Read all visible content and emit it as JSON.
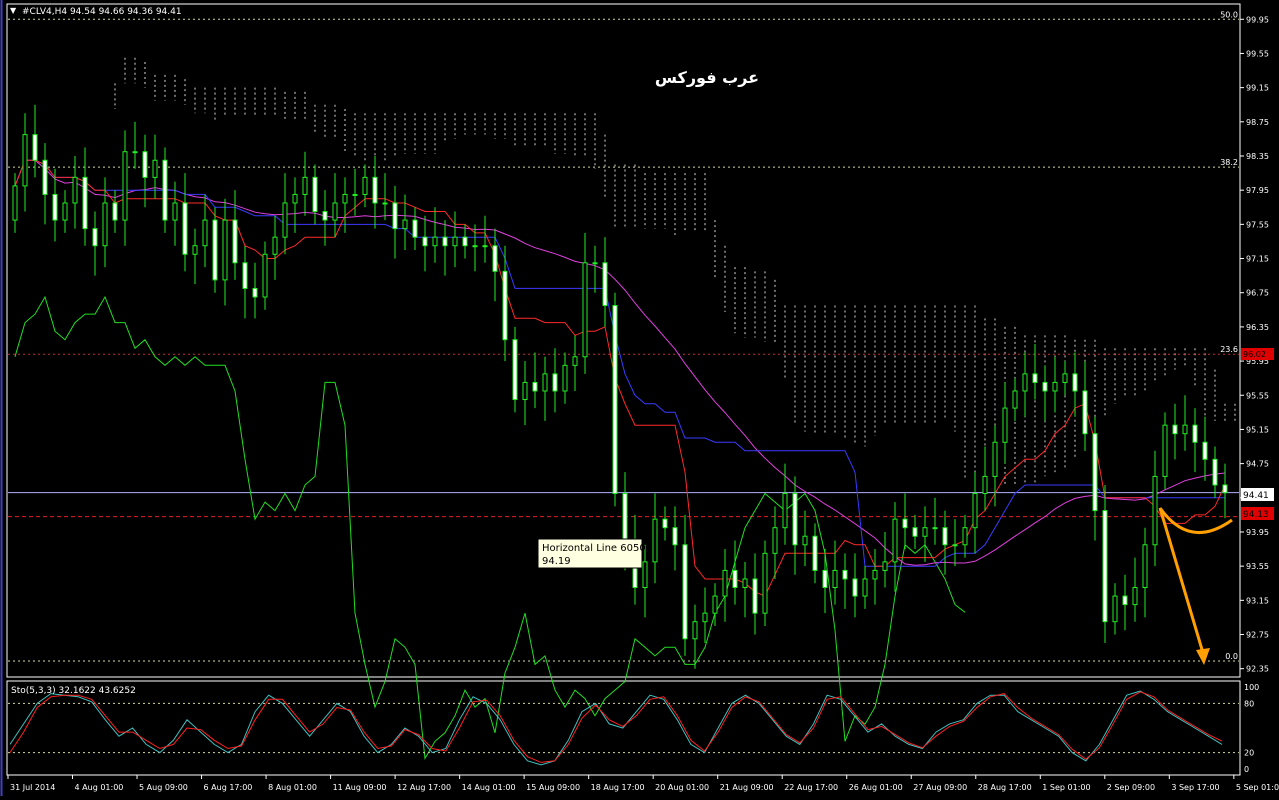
{
  "header": {
    "symbol_info": "#CLV4,H4  94.54 94.66 94.36 94.41",
    "watermark": "عرب فوركس"
  },
  "indicator": {
    "label": "Sto(5,3,3) 32.1622 43.6252",
    "levels": [
      100,
      80,
      20,
      0
    ],
    "level_labels": [
      "100",
      "80",
      "20",
      "0"
    ]
  },
  "fib": {
    "levels": [
      {
        "label": "50.0",
        "price": 99.95
      },
      {
        "label": "38.2",
        "price": 98.22
      },
      {
        "label": "23.6",
        "price": 96.03
      },
      {
        "label": "0.0",
        "price": 92.44
      }
    ]
  },
  "tooltip": {
    "line1": "Horizontal Line 6050",
    "line2": "94.19"
  },
  "price_tags": {
    "current": "94.41",
    "red_level": "94.13",
    "red_level_top": "96.02"
  },
  "chart_data": [
    {
      "type": "candlestick",
      "ylim": [
        92.44,
        100.0
      ],
      "y_ticks": [
        "99.95",
        "99.55",
        "99.15",
        "98.75",
        "98.35",
        "97.95",
        "97.55",
        "97.15",
        "96.75",
        "96.35",
        "95.95",
        "95.55",
        "95.15",
        "94.75",
        "94.35",
        "93.95",
        "93.55",
        "93.15",
        "92.75",
        "92.35"
      ],
      "x_ticks": [
        "31 Jul 2014",
        "4 Aug 01:00",
        "5 Aug 09:00",
        "6 Aug 17:00",
        "8 Aug 01:00",
        "11 Aug 09:00",
        "12 Aug 17:00",
        "14 Aug 01:00",
        "15 Aug 09:00",
        "18 Aug 17:00",
        "20 Aug 01:00",
        "21 Aug 09:00",
        "22 Aug 17:00",
        "26 Aug 01:00",
        "27 Aug 09:00",
        "28 Aug 17:00",
        "1 Sep 01:00",
        "2 Sep 09:00",
        "3 Sep 17:00",
        "5 Sep 01:00"
      ],
      "closes": [
        98.0,
        98.6,
        98.3,
        97.9,
        97.6,
        97.8,
        98.1,
        97.5,
        97.3,
        97.8,
        97.6,
        98.4,
        98.4,
        98.1,
        98.3,
        97.6,
        97.8,
        97.2,
        97.3,
        97.6,
        96.9,
        97.6,
        97.1,
        96.8,
        96.7,
        97.2,
        97.4,
        97.8,
        97.9,
        98.1,
        97.7,
        97.6,
        97.8,
        97.9,
        97.9,
        98.1,
        97.8,
        97.8,
        97.5,
        97.6,
        97.4,
        97.3,
        97.4,
        97.3,
        97.4,
        97.3,
        97.3,
        97.3,
        97.0,
        96.2,
        95.5,
        95.7,
        95.6,
        95.8,
        95.6,
        95.9,
        96.0,
        97.1,
        97.1,
        96.6,
        94.4,
        93.8,
        93.3,
        93.6,
        94.1,
        94.0,
        93.8,
        92.7,
        92.9,
        93.0,
        93.2,
        93.5,
        93.3,
        93.4,
        93.0,
        93.7,
        94.0,
        94.4,
        93.8,
        93.9,
        93.5,
        93.3,
        93.5,
        93.4,
        93.2,
        93.4,
        93.5,
        93.6,
        94.1,
        94.0,
        93.9,
        94.0,
        94.0,
        93.8,
        93.8,
        94.0,
        94.4,
        94.6,
        95.0,
        95.4,
        95.6,
        95.8,
        95.7,
        95.6,
        95.7,
        95.8,
        95.6,
        95.1,
        94.2,
        92.9,
        93.2,
        93.1,
        93.3,
        93.8,
        94.6,
        95.2,
        95.1,
        95.2,
        95.0,
        94.8,
        94.5,
        94.41
      ],
      "series": [
        {
          "name": "",
          "color": "#ff2a2a"
        },
        {
          "name": "",
          "color": "#3a3aff"
        },
        {
          "name": "",
          "color": "#e040e0"
        },
        {
          "name": "",
          "color": "#22dd22"
        }
      ]
    },
    {
      "type": "line",
      "ylim": [
        0,
        100
      ],
      "series": [
        {
          "name": "",
          "color": "#40c0c0",
          "values": [
            30,
            55,
            80,
            92,
            90,
            88,
            82,
            60,
            40,
            50,
            30,
            20,
            35,
            60,
            45,
            30,
            20,
            30,
            70,
            90,
            80,
            60,
            40,
            60,
            80,
            70,
            40,
            20,
            30,
            50,
            40,
            20,
            25,
            60,
            88,
            80,
            60,
            30,
            10,
            5,
            10,
            35,
            70,
            80,
            55,
            50,
            70,
            90,
            85,
            60,
            30,
            20,
            50,
            80,
            90,
            80,
            60,
            40,
            30,
            55,
            90,
            85,
            65,
            45,
            55,
            40,
            30,
            25,
            45,
            55,
            60,
            80,
            90,
            90,
            70,
            60,
            50,
            40,
            20,
            10,
            30,
            60,
            90,
            95,
            85,
            70,
            60,
            50,
            40,
            30
          ]
        },
        {
          "name": "",
          "color": "#ff2020",
          "values": [
            20,
            45,
            75,
            88,
            90,
            90,
            85,
            65,
            45,
            45,
            35,
            25,
            30,
            50,
            48,
            35,
            25,
            28,
            60,
            85,
            85,
            65,
            45,
            55,
            75,
            72,
            45,
            25,
            28,
            48,
            42,
            25,
            22,
            50,
            82,
            84,
            65,
            35,
            15,
            8,
            10,
            30,
            62,
            78,
            60,
            52,
            65,
            85,
            88,
            65,
            35,
            22,
            45,
            75,
            88,
            82,
            62,
            42,
            32,
            50,
            85,
            88,
            68,
            48,
            52,
            42,
            32,
            26,
            40,
            52,
            58,
            75,
            88,
            92,
            75,
            62,
            52,
            42,
            24,
            12,
            26,
            55,
            85,
            94,
            88,
            72,
            62,
            52,
            42,
            34
          ]
        }
      ]
    }
  ]
}
